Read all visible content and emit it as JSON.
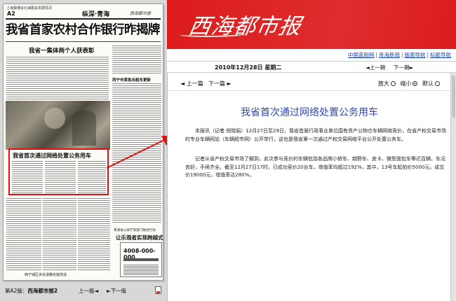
{
  "newspaper_page": {
    "masthead_small": "上海报博会北海展会发展情况",
    "page_code": "A2",
    "section": "纵深·青海",
    "paper_logo": "西海都市报",
    "headline": "我省首家农村合作银行昨揭牌",
    "subhead_1": "我省一集体两个人获表彰",
    "subhead_right": "西宁市首批出租车更新",
    "highlighted_title": "我省首次通过网络处置公务用车",
    "subhead_2": "青海省公安厅等部门联合行动",
    "subhead_3": "让乐观者实现跨越式发展",
    "subhead_4": "西宁城区多处道路实施改造",
    "ad_phone": "4008-000-000"
  },
  "page_footer": {
    "page_label_prefix": "第A2版：",
    "page_label_name": "西海都市报2",
    "prev_page": "上一版",
    "next_page": "下一版",
    "prev_arrow": "◄",
    "next_arrow": "►"
  },
  "header": {
    "logo_text": "西海都市报",
    "nav_links": [
      "中国蓝韵网",
      "青海新闻",
      "版面导航",
      "标题导航"
    ],
    "nav_separator": "|"
  },
  "datebar": {
    "date": "2010年12月28日  星期二",
    "prev_issue": "上一期",
    "next_issue": "下一期"
  },
  "toolbar": {
    "prev_article": "上一篇",
    "next_article": "下一篇",
    "zoom_in": "放大",
    "zoom_out": "缩小",
    "default": "默认"
  },
  "article": {
    "title": "我省首次通过网络处置公务用车",
    "paragraph_1": "本报讯（记者 倪晓娟）12月27日至29日，我省首届行政事业单位国有资产公物仓车辆网络竞价，在省产权交易市场的专业车辆网站（车辆超市网）公开举行，这也是我省第一次通过产权交易网络平台公开处置公务车。",
    "paragraph_2": "记者从省产权交易市场了解到，此次参与竞价的车辆包括各品牌小轿车、越野车、皮卡、微型面包车等近百辆，车况良好，手续齐全。截至12月27日17时，已成功竞价20台车，增值率均超过192%，其中，13号车起拍价5000元，成交价19000元，增值率达280%。"
  },
  "colors": {
    "banner_red": "#dc1b1b",
    "link_blue": "#1846b0",
    "title_blue": "#2c47b5",
    "highlight_red": "#e01010"
  }
}
